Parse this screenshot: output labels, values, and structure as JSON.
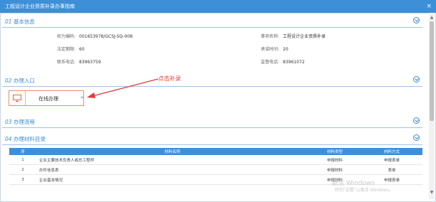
{
  "window": {
    "title": "工程设计企业资质补录办事指南",
    "close_glyph": "×"
  },
  "sections": {
    "basic": {
      "num": "01",
      "label": "基本信息"
    },
    "entry": {
      "num": "02",
      "label": "办理入口"
    },
    "process": {
      "num": "03",
      "label": "办理流程"
    },
    "materials": {
      "num": "04",
      "label": "办理材料目录"
    }
  },
  "basic_info": {
    "power_code_label": "权力编码:",
    "power_code_value": "001653978/GCSJ-SQ-008",
    "item_name_label": "事项名称:",
    "item_name_value": "工程设计企业资质补录",
    "legal_limit_label": "法定期限:",
    "legal_limit_value": "60",
    "promise_time_label": "承诺时间:",
    "promise_time_value": "20",
    "contact_phone_label": "联系电话:",
    "contact_phone_value": "83963759",
    "supervise_phone_label": "监督电话:",
    "supervise_phone_value": "83961072"
  },
  "entry": {
    "online_label": "在线办理",
    "arrow_glyph": "»",
    "annotation": "点击补录"
  },
  "materials_table": {
    "headers": [
      "序",
      "材料名称",
      "材料类型",
      "材料方式"
    ],
    "rows": [
      [
        "1",
        "企业主要技术负责人或总工程师",
        "申报材料",
        "申报表单"
      ],
      [
        "2",
        "办件信息表",
        "申报材料",
        "表单"
      ],
      [
        "3",
        "企业基本情况",
        "申报材料",
        "申报表单"
      ]
    ]
  },
  "watermark": {
    "line1": "激活 Windows",
    "line2": "转到\"设置\"以激活 Windows。"
  },
  "colors": {
    "accent": "#3d8fd8",
    "annotation": "#e13b3b",
    "button_border": "#f08a6a"
  }
}
